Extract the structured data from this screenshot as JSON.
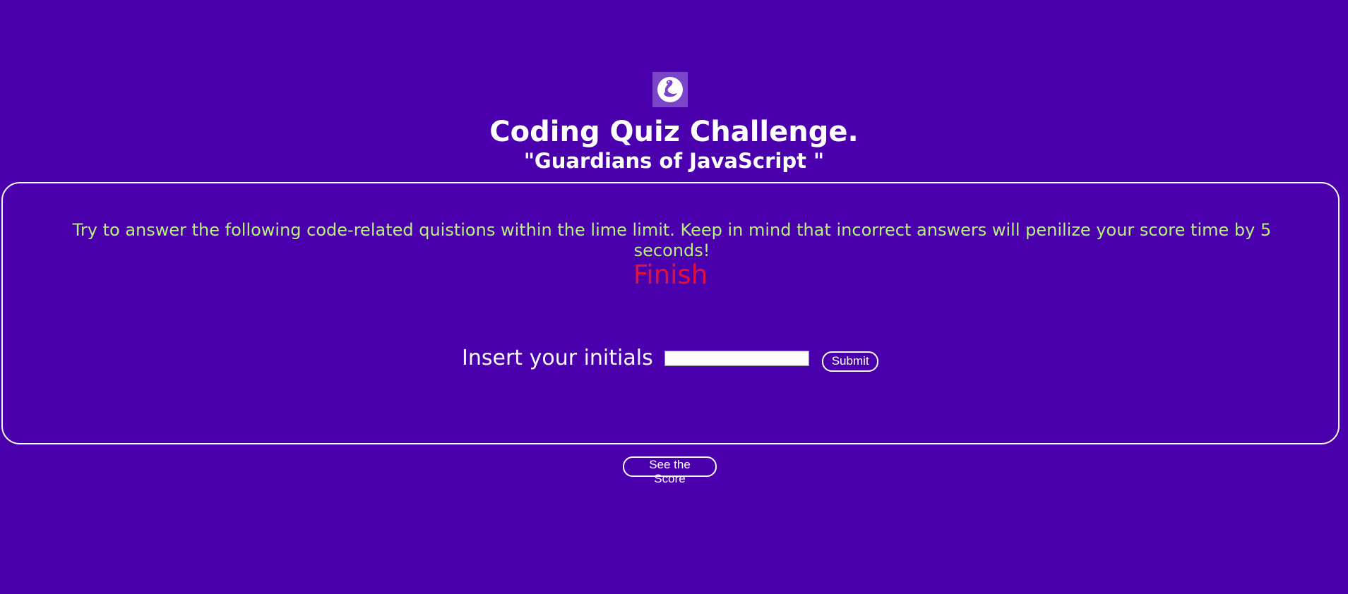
{
  "header": {
    "logo_icon": "swan-icon",
    "title": "Coding Quiz Challenge.",
    "subtitle": "\"Guardians of JavaScript \""
  },
  "card": {
    "instructions": "Try to answer the following code-related quistions within the lime limit. Keep in mind that incorrect answers will penilize your score time by 5 seconds!",
    "finish": "Finish",
    "initials_label": "Insert your initials",
    "initials_value": "",
    "submit_label": "Submit"
  },
  "footer": {
    "score_label": "See the Score"
  },
  "colors": {
    "background": "#4b00ae",
    "instructions": "#b7f07a",
    "finish": "#e0113a",
    "logo_bg": "#7a45c8"
  }
}
